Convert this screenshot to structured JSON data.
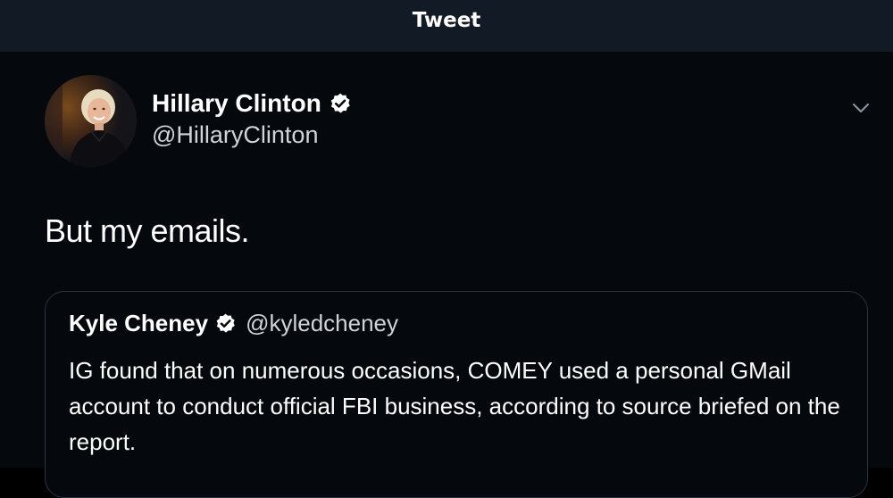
{
  "header": {
    "title": "Tweet"
  },
  "tweet": {
    "author": {
      "name": "Hillary Clinton",
      "handle": "@HillaryClinton",
      "verified": true,
      "avatar": "portrait-photo"
    },
    "text": "But my emails.",
    "menu_icon": "chevron-down-icon",
    "quote": {
      "author": {
        "name": "Kyle Cheney",
        "handle": "@kyledcheney",
        "verified": true
      },
      "text": "IG found that on numerous occasions, COMEY used a personal GMail account to conduct official FBI business, according to source briefed on the report."
    }
  },
  "colors": {
    "background": "#05080d",
    "header_background": "#121a26",
    "text": "#ffffff",
    "secondary_text": "#d0d4da",
    "border": "#2b3340"
  }
}
